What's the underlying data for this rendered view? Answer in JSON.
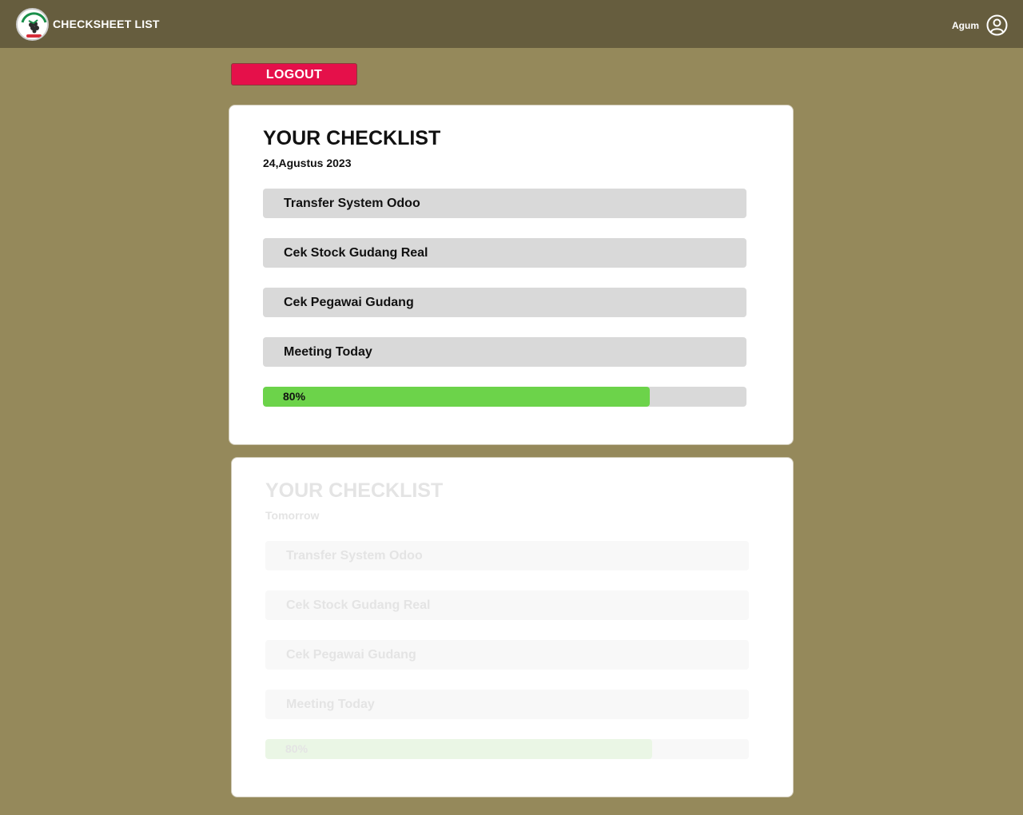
{
  "header": {
    "app_title": "CHECKSHEET LIST",
    "username": "Agum",
    "logo_icon": "grape-brand-logo",
    "user_icon": "user-circle-icon",
    "bar_color": "#665d3e"
  },
  "actions": {
    "logout_label": "LOGOUT",
    "logout_color": "#e5104a"
  },
  "checklists": [
    {
      "title": "YOUR CHECKLIST",
      "date": "24,Agustus 2023",
      "tasks": [
        "Transfer System Odoo",
        "Cek Stock Gudang Real",
        "Cek Pegawai Gudang",
        "Meeting Today"
      ],
      "progress_label": "80%",
      "progress_value": 0.8,
      "state": "active"
    },
    {
      "title": "YOUR CHECKLIST",
      "date": "Tomorrow",
      "tasks": [
        "Transfer System Odoo",
        "Cek Stock Gudang Real",
        "Cek Pegawai Gudang",
        "Meeting Today"
      ],
      "progress_label": "80%",
      "progress_value": 0.8,
      "state": "faded"
    }
  ],
  "colors": {
    "background": "#95895b",
    "progress_fill": "#6cd34a",
    "task_bg": "#d9d9d9"
  }
}
